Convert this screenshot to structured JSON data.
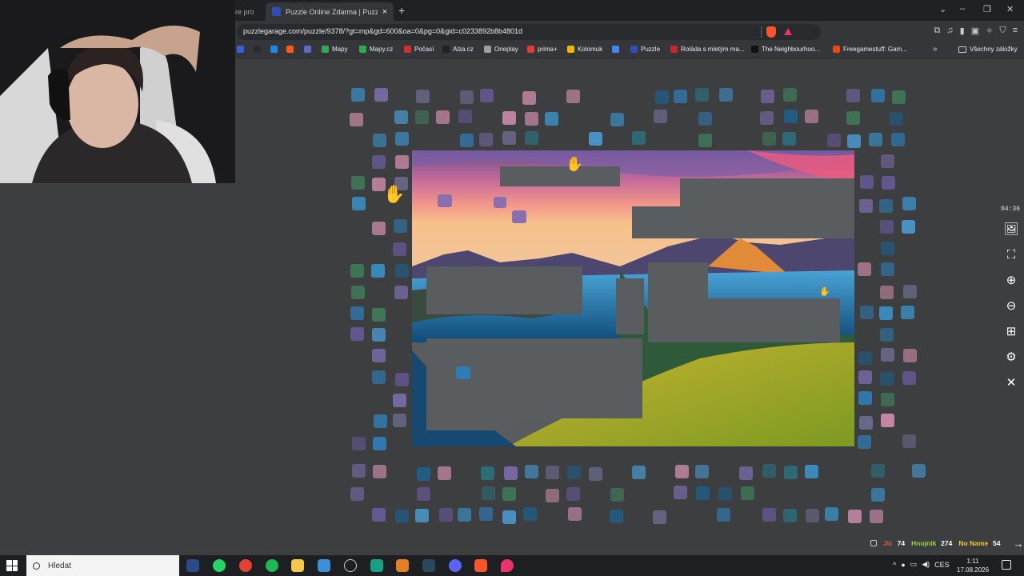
{
  "browser": {
    "prev_tab_title": "re pro",
    "active_tab_title": "Puzzle Online Zdarma | Puzzle G",
    "new_tab_symbol": "+",
    "url": "puzzlegarage.com/puzzle/9378/?gt=mp&gd=600&oa=0&pg=0&gid=c0233892b8b4801d",
    "bookmarks": [
      {
        "label": "",
        "color": "#3b5bdb"
      },
      {
        "label": "",
        "color": "#2b2b2b"
      },
      {
        "label": "",
        "color": "#1e88e5"
      },
      {
        "label": "",
        "color": "#ff5722"
      },
      {
        "label": "",
        "color": "#5c6bc0"
      },
      {
        "label": "Mapy",
        "color": "#34a853"
      },
      {
        "label": "Mapy.cz",
        "color": "#2fa84f"
      },
      {
        "label": "Počasí",
        "color": "#d32f2f"
      },
      {
        "label": "Alza.cz",
        "color": "#222222"
      },
      {
        "label": "Oneplay",
        "color": "#9e9e9e"
      },
      {
        "label": "prima+",
        "color": "#e53935"
      },
      {
        "label": "Kolomuk",
        "color": "#f4b400"
      },
      {
        "label": "",
        "color": "#4285f4"
      },
      {
        "label": "Puzzle",
        "color": "#2f4fb3"
      },
      {
        "label": "Roláda s mletým ma...",
        "color": "#c62828"
      },
      {
        "label": "The Neighbourhoo...",
        "color": "#111111"
      },
      {
        "label": "Freegamestuff: Gam...",
        "color": "#e64a19"
      }
    ],
    "bookmarks_overflow": "»",
    "all_bookmarks": "Všechny záložky"
  },
  "game": {
    "timer": "04:36",
    "sidebar_buttons": [
      "image-icon",
      "fullscreen-icon",
      "zoom-in-icon",
      "zoom-out-icon",
      "grid-icon",
      "settings-icon",
      "close-icon"
    ],
    "players": [
      {
        "name": "Jic",
        "score": "74",
        "color": "#e35a4c"
      },
      {
        "name": "Hnojník",
        "score": "274",
        "color": "#9bd24a"
      },
      {
        "name": "No Name",
        "score": "54",
        "color": "#f2c531"
      }
    ]
  },
  "taskbar": {
    "search_placeholder": "Hledat",
    "language": "CES",
    "time": "1:11",
    "date": "17.08.2026"
  }
}
